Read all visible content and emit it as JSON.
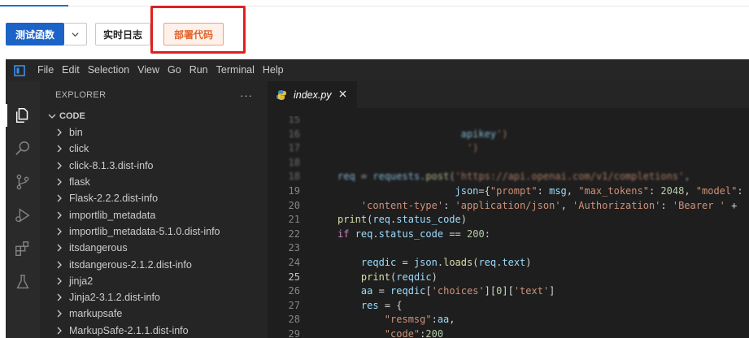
{
  "toolbar": {
    "test_function_label": "测试函数",
    "realtime_log_label": "实时日志",
    "deploy_code_label": "部署代码"
  },
  "menubar": {
    "items": [
      "File",
      "Edit",
      "Selection",
      "View",
      "Go",
      "Run",
      "Terminal",
      "Help"
    ]
  },
  "explorer": {
    "title": "EXPLORER",
    "more": "···",
    "section": "CODE",
    "items": [
      "bin",
      "click",
      "click-8.1.3.dist-info",
      "flask",
      "Flask-2.2.2.dist-info",
      "importlib_metadata",
      "importlib_metadata-5.1.0.dist-info",
      "itsdangerous",
      "itsdangerous-2.1.2.dist-info",
      "jinja2",
      "Jinja2-3.1.2.dist-info",
      "markupsafe",
      "MarkupSafe-2.1.1.dist-info"
    ]
  },
  "editor": {
    "tab_label": "index.py",
    "lines": [
      {
        "num": "15",
        "text": ""
      },
      {
        "num": "16",
        "text": "                     apikey')"
      },
      {
        "num": "17",
        "text": "                      ')"
      },
      {
        "num": "18",
        "text": ""
      },
      {
        "num": "18",
        "text": "req = requests.post('https://api.openai.com/v1/completions',"
      },
      {
        "num": "19",
        "text": "                    json={\"prompt\": msg, \"max_tokens\": 2048, \"model\": \"t"
      },
      {
        "num": "20",
        "text": "    'content-type': 'application/json', 'Authorization': 'Bearer ' +"
      },
      {
        "num": "21",
        "text": "print(req.status_code)"
      },
      {
        "num": "22",
        "text": "if req.status_code == 200:"
      },
      {
        "num": "23",
        "text": ""
      },
      {
        "num": "24",
        "text": "    reqdic = json.loads(req.text)"
      },
      {
        "num": "25",
        "text": "    print(reqdic)"
      },
      {
        "num": "26",
        "text": "    aa = reqdic['choices'][0]['text']"
      },
      {
        "num": "27",
        "text": "    res = {"
      },
      {
        "num": "28",
        "text": "        \"resmsg\":aa,"
      },
      {
        "num": "29",
        "text": "        \"code\":200"
      }
    ]
  },
  "colors": {
    "primary_button": "#1b63c6",
    "deploy_text": "#e2632a",
    "highlight_box": "#e02020",
    "editor_bg": "#1e1e1e",
    "sidebar_bg": "#252526"
  }
}
